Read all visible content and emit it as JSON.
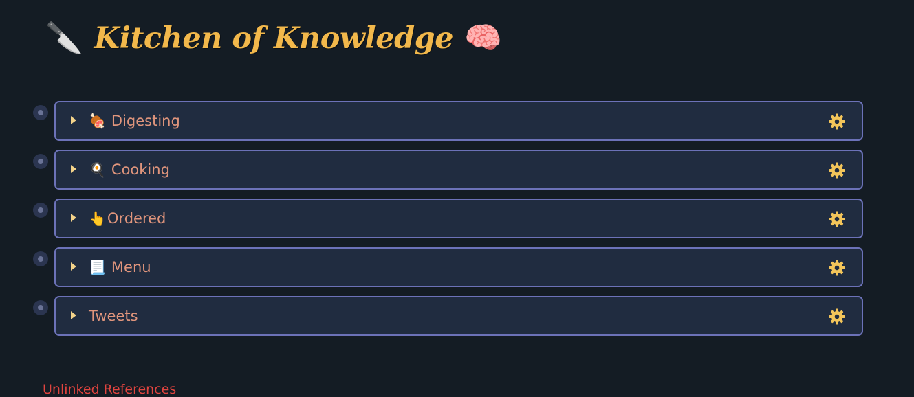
{
  "page": {
    "title": "Kitchen of Knowledge",
    "title_icon_left": "🔪",
    "title_icon_right": "🧠",
    "title_color": "#f2b84b"
  },
  "blocks": [
    {
      "emoji": "🍖",
      "label": "Digesting",
      "icon": "meat-icon"
    },
    {
      "emoji": "🍳",
      "label": "Cooking",
      "icon": "frying-pan-icon"
    },
    {
      "emoji": "👆",
      "label": "Ordered",
      "icon": "pointing-hand-icon"
    },
    {
      "emoji": "📃",
      "label": "Menu",
      "icon": "page-icon"
    },
    {
      "emoji": "",
      "label": "Tweets",
      "icon": ""
    }
  ],
  "unlinked_references": {
    "label": "Unlinked References",
    "color": "#e0443f"
  },
  "colors": {
    "background": "#141c24",
    "card_background": "#202c40",
    "card_border": "#6c72b8",
    "label_text": "#e0957c",
    "gear": "#f3c55a"
  }
}
